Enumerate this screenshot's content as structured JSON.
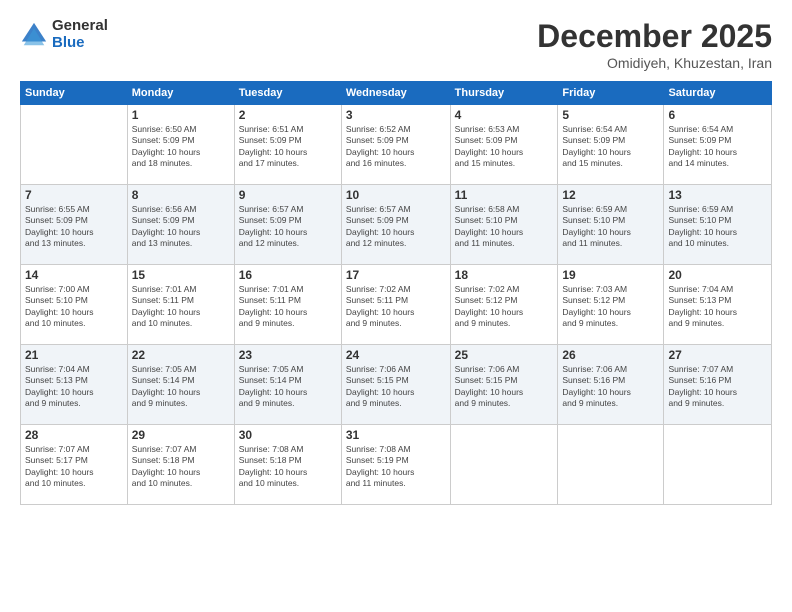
{
  "logo": {
    "general": "General",
    "blue": "Blue"
  },
  "title": "December 2025",
  "subtitle": "Omidiyeh, Khuzestan, Iran",
  "days_of_week": [
    "Sunday",
    "Monday",
    "Tuesday",
    "Wednesday",
    "Thursday",
    "Friday",
    "Saturday"
  ],
  "weeks": [
    [
      {
        "num": "",
        "info": ""
      },
      {
        "num": "1",
        "info": "Sunrise: 6:50 AM\nSunset: 5:09 PM\nDaylight: 10 hours\nand 18 minutes."
      },
      {
        "num": "2",
        "info": "Sunrise: 6:51 AM\nSunset: 5:09 PM\nDaylight: 10 hours\nand 17 minutes."
      },
      {
        "num": "3",
        "info": "Sunrise: 6:52 AM\nSunset: 5:09 PM\nDaylight: 10 hours\nand 16 minutes."
      },
      {
        "num": "4",
        "info": "Sunrise: 6:53 AM\nSunset: 5:09 PM\nDaylight: 10 hours\nand 15 minutes."
      },
      {
        "num": "5",
        "info": "Sunrise: 6:54 AM\nSunset: 5:09 PM\nDaylight: 10 hours\nand 15 minutes."
      },
      {
        "num": "6",
        "info": "Sunrise: 6:54 AM\nSunset: 5:09 PM\nDaylight: 10 hours\nand 14 minutes."
      }
    ],
    [
      {
        "num": "7",
        "info": "Sunrise: 6:55 AM\nSunset: 5:09 PM\nDaylight: 10 hours\nand 13 minutes."
      },
      {
        "num": "8",
        "info": "Sunrise: 6:56 AM\nSunset: 5:09 PM\nDaylight: 10 hours\nand 13 minutes."
      },
      {
        "num": "9",
        "info": "Sunrise: 6:57 AM\nSunset: 5:09 PM\nDaylight: 10 hours\nand 12 minutes."
      },
      {
        "num": "10",
        "info": "Sunrise: 6:57 AM\nSunset: 5:09 PM\nDaylight: 10 hours\nand 12 minutes."
      },
      {
        "num": "11",
        "info": "Sunrise: 6:58 AM\nSunset: 5:10 PM\nDaylight: 10 hours\nand 11 minutes."
      },
      {
        "num": "12",
        "info": "Sunrise: 6:59 AM\nSunset: 5:10 PM\nDaylight: 10 hours\nand 11 minutes."
      },
      {
        "num": "13",
        "info": "Sunrise: 6:59 AM\nSunset: 5:10 PM\nDaylight: 10 hours\nand 10 minutes."
      }
    ],
    [
      {
        "num": "14",
        "info": "Sunrise: 7:00 AM\nSunset: 5:10 PM\nDaylight: 10 hours\nand 10 minutes."
      },
      {
        "num": "15",
        "info": "Sunrise: 7:01 AM\nSunset: 5:11 PM\nDaylight: 10 hours\nand 10 minutes."
      },
      {
        "num": "16",
        "info": "Sunrise: 7:01 AM\nSunset: 5:11 PM\nDaylight: 10 hours\nand 9 minutes."
      },
      {
        "num": "17",
        "info": "Sunrise: 7:02 AM\nSunset: 5:11 PM\nDaylight: 10 hours\nand 9 minutes."
      },
      {
        "num": "18",
        "info": "Sunrise: 7:02 AM\nSunset: 5:12 PM\nDaylight: 10 hours\nand 9 minutes."
      },
      {
        "num": "19",
        "info": "Sunrise: 7:03 AM\nSunset: 5:12 PM\nDaylight: 10 hours\nand 9 minutes."
      },
      {
        "num": "20",
        "info": "Sunrise: 7:04 AM\nSunset: 5:13 PM\nDaylight: 10 hours\nand 9 minutes."
      }
    ],
    [
      {
        "num": "21",
        "info": "Sunrise: 7:04 AM\nSunset: 5:13 PM\nDaylight: 10 hours\nand 9 minutes."
      },
      {
        "num": "22",
        "info": "Sunrise: 7:05 AM\nSunset: 5:14 PM\nDaylight: 10 hours\nand 9 minutes."
      },
      {
        "num": "23",
        "info": "Sunrise: 7:05 AM\nSunset: 5:14 PM\nDaylight: 10 hours\nand 9 minutes."
      },
      {
        "num": "24",
        "info": "Sunrise: 7:06 AM\nSunset: 5:15 PM\nDaylight: 10 hours\nand 9 minutes."
      },
      {
        "num": "25",
        "info": "Sunrise: 7:06 AM\nSunset: 5:15 PM\nDaylight: 10 hours\nand 9 minutes."
      },
      {
        "num": "26",
        "info": "Sunrise: 7:06 AM\nSunset: 5:16 PM\nDaylight: 10 hours\nand 9 minutes."
      },
      {
        "num": "27",
        "info": "Sunrise: 7:07 AM\nSunset: 5:16 PM\nDaylight: 10 hours\nand 9 minutes."
      }
    ],
    [
      {
        "num": "28",
        "info": "Sunrise: 7:07 AM\nSunset: 5:17 PM\nDaylight: 10 hours\nand 10 minutes."
      },
      {
        "num": "29",
        "info": "Sunrise: 7:07 AM\nSunset: 5:18 PM\nDaylight: 10 hours\nand 10 minutes."
      },
      {
        "num": "30",
        "info": "Sunrise: 7:08 AM\nSunset: 5:18 PM\nDaylight: 10 hours\nand 10 minutes."
      },
      {
        "num": "31",
        "info": "Sunrise: 7:08 AM\nSunset: 5:19 PM\nDaylight: 10 hours\nand 11 minutes."
      },
      {
        "num": "",
        "info": ""
      },
      {
        "num": "",
        "info": ""
      },
      {
        "num": "",
        "info": ""
      }
    ]
  ]
}
